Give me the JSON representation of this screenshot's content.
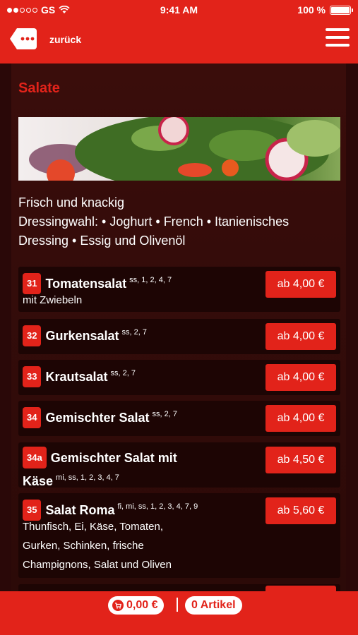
{
  "status": {
    "carrier": "GS",
    "time": "9:41 AM",
    "battery": "100 %"
  },
  "header": {
    "back_label": "zurück"
  },
  "section": {
    "title": "Salate",
    "description": [
      "Frisch und knackig",
      "Dressingwahl: • Joghurt • French • Itanienisches",
      "Dressing • Essig und Olivenöl"
    ]
  },
  "items": [
    {
      "num": "31",
      "name": "Tomatensalat",
      "allergens": "ss, 1, 2, 4, 7",
      "sub": "mit Zwiebeln",
      "price": "ab 4,00 €"
    },
    {
      "num": "32",
      "name": "Gurkensalat",
      "allergens": "ss, 2, 7",
      "price": "ab 4,00 €"
    },
    {
      "num": "33",
      "name": "Krautsalat",
      "allergens": "ss, 2, 7",
      "price": "ab 4,00 €"
    },
    {
      "num": "34",
      "name": "Gemischter Salat",
      "allergens": "ss, 2, 7",
      "price": "ab 4,00 €"
    },
    {
      "num": "34a",
      "name": "Gemischter Salat mit",
      "name2": "Käse",
      "allergens": "mi, ss, 1, 2, 3, 4, 7",
      "price": "ab 4,50 €"
    },
    {
      "num": "35",
      "name": "Salat Roma",
      "allergens": "fi, mi, ss, 1, 2, 3, 4, 7, 9",
      "sub": [
        "Thunfisch, Ei, Käse, Tomaten,",
        "Gurken, Schinken, frische",
        "Champignons, Salat und Oliven"
      ],
      "price": "ab 5,60 €"
    }
  ],
  "footer": {
    "cart_total": "0,00 €",
    "articles": "0 Artikel"
  }
}
